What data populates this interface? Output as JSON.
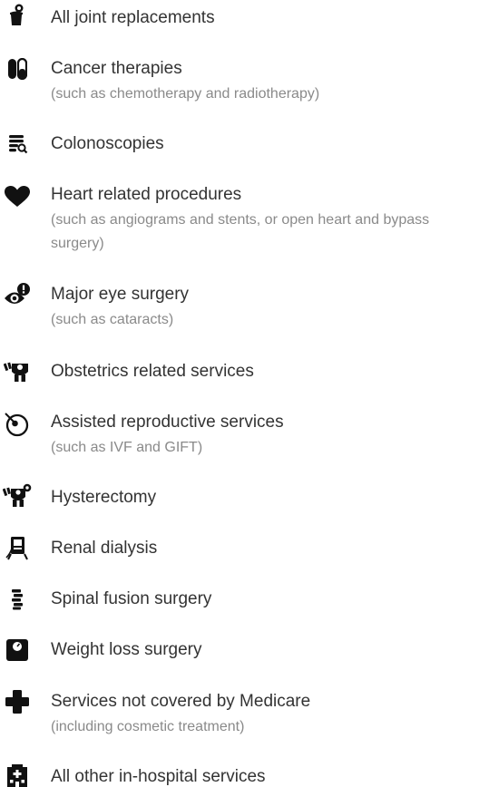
{
  "procedures": {
    "items": [
      {
        "icon": "joint-replacement-icon",
        "title": "All joint replacements",
        "note": ""
      },
      {
        "icon": "capsule-icon",
        "title": "Cancer therapies",
        "note": "(such as chemotherapy and radiotherapy)"
      },
      {
        "icon": "colonoscopy-icon",
        "title": "Colonoscopies",
        "note": ""
      },
      {
        "icon": "heart-icon",
        "title": "Heart related procedures",
        "note": "(such as angiograms and stents, or open heart and bypass surgery)"
      },
      {
        "icon": "eye-alert-icon",
        "title": "Major eye surgery",
        "note": "(such as cataracts)"
      },
      {
        "icon": "obstetrics-icon",
        "title": "Obstetrics related services",
        "note": ""
      },
      {
        "icon": "reproductive-icon",
        "title": "Assisted reproductive services",
        "note": "(such as IVF and GIFT)"
      },
      {
        "icon": "hysterectomy-icon",
        "title": "Hysterectomy",
        "note": ""
      },
      {
        "icon": "dialysis-icon",
        "title": "Renal dialysis",
        "note": ""
      },
      {
        "icon": "spine-icon",
        "title": "Spinal fusion surgery",
        "note": ""
      },
      {
        "icon": "weight-scale-icon",
        "title": "Weight loss surgery",
        "note": ""
      },
      {
        "icon": "medical-cross-icon",
        "title": "Services not covered by Medicare",
        "note": "(including cosmetic treatment)"
      },
      {
        "icon": "hospital-icon",
        "title": "All other in-hospital services",
        "note": ""
      }
    ]
  }
}
